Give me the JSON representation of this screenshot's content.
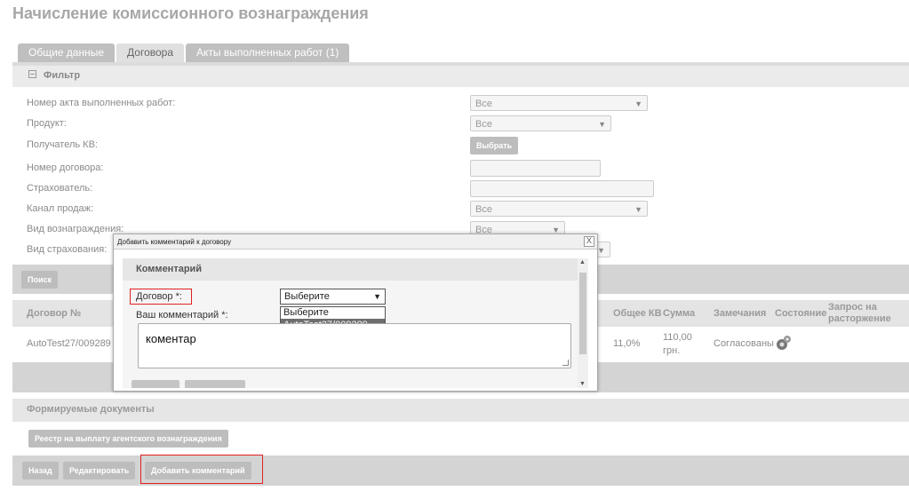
{
  "page_title": "Начисление комиссионного вознаграждения",
  "tabs": [
    "Общие данные",
    "Договора",
    "Акты выполненных работ (1)"
  ],
  "filter": {
    "title": "Фильтр",
    "act_label": "Номер акта выполненных работ:",
    "act_value": "Все",
    "product_label": "Продукт:",
    "product_value": "Все",
    "recipient_label": "Получатель КВ:",
    "recipient_button": "Выбрать",
    "contract_label": "Номер договора:",
    "insurer_label": "Страхователь:",
    "channel_label": "Канал продаж:",
    "channel_value": "Все",
    "reward_type_label": "Вид вознаграждения:",
    "reward_type_value": "Все",
    "insurance_type_label": "Вид страхования:",
    "search_button": "Поиск"
  },
  "table": {
    "headers": [
      "Договор №",
      "Общее КВ",
      "Сумма",
      "Замечания",
      "Состояние",
      "Запрос на расторжение"
    ],
    "row": {
      "contract": "AutoTest27/009289",
      "kv": "11,0%",
      "sum_value": "110,00",
      "sum_currency": "грн.",
      "remarks": "Согласованы"
    }
  },
  "documents": {
    "title": "Формируемые документы",
    "registry_button": "Реестр на выплату агентского вознаграждения"
  },
  "actions": {
    "back": "Назад",
    "edit": "Редактировать",
    "add_comment": "Добавить комментарий"
  },
  "dialog": {
    "title": "Добавить комментарий к договору",
    "close": "X",
    "section": "Комментарий",
    "contract_label": "Договор *:",
    "contract_selected": "Выберите",
    "contract_options": [
      "Выберите",
      "AutoTest27/009289"
    ],
    "comment_label": "Ваш комментарий *:",
    "comment_value": "коментар"
  }
}
